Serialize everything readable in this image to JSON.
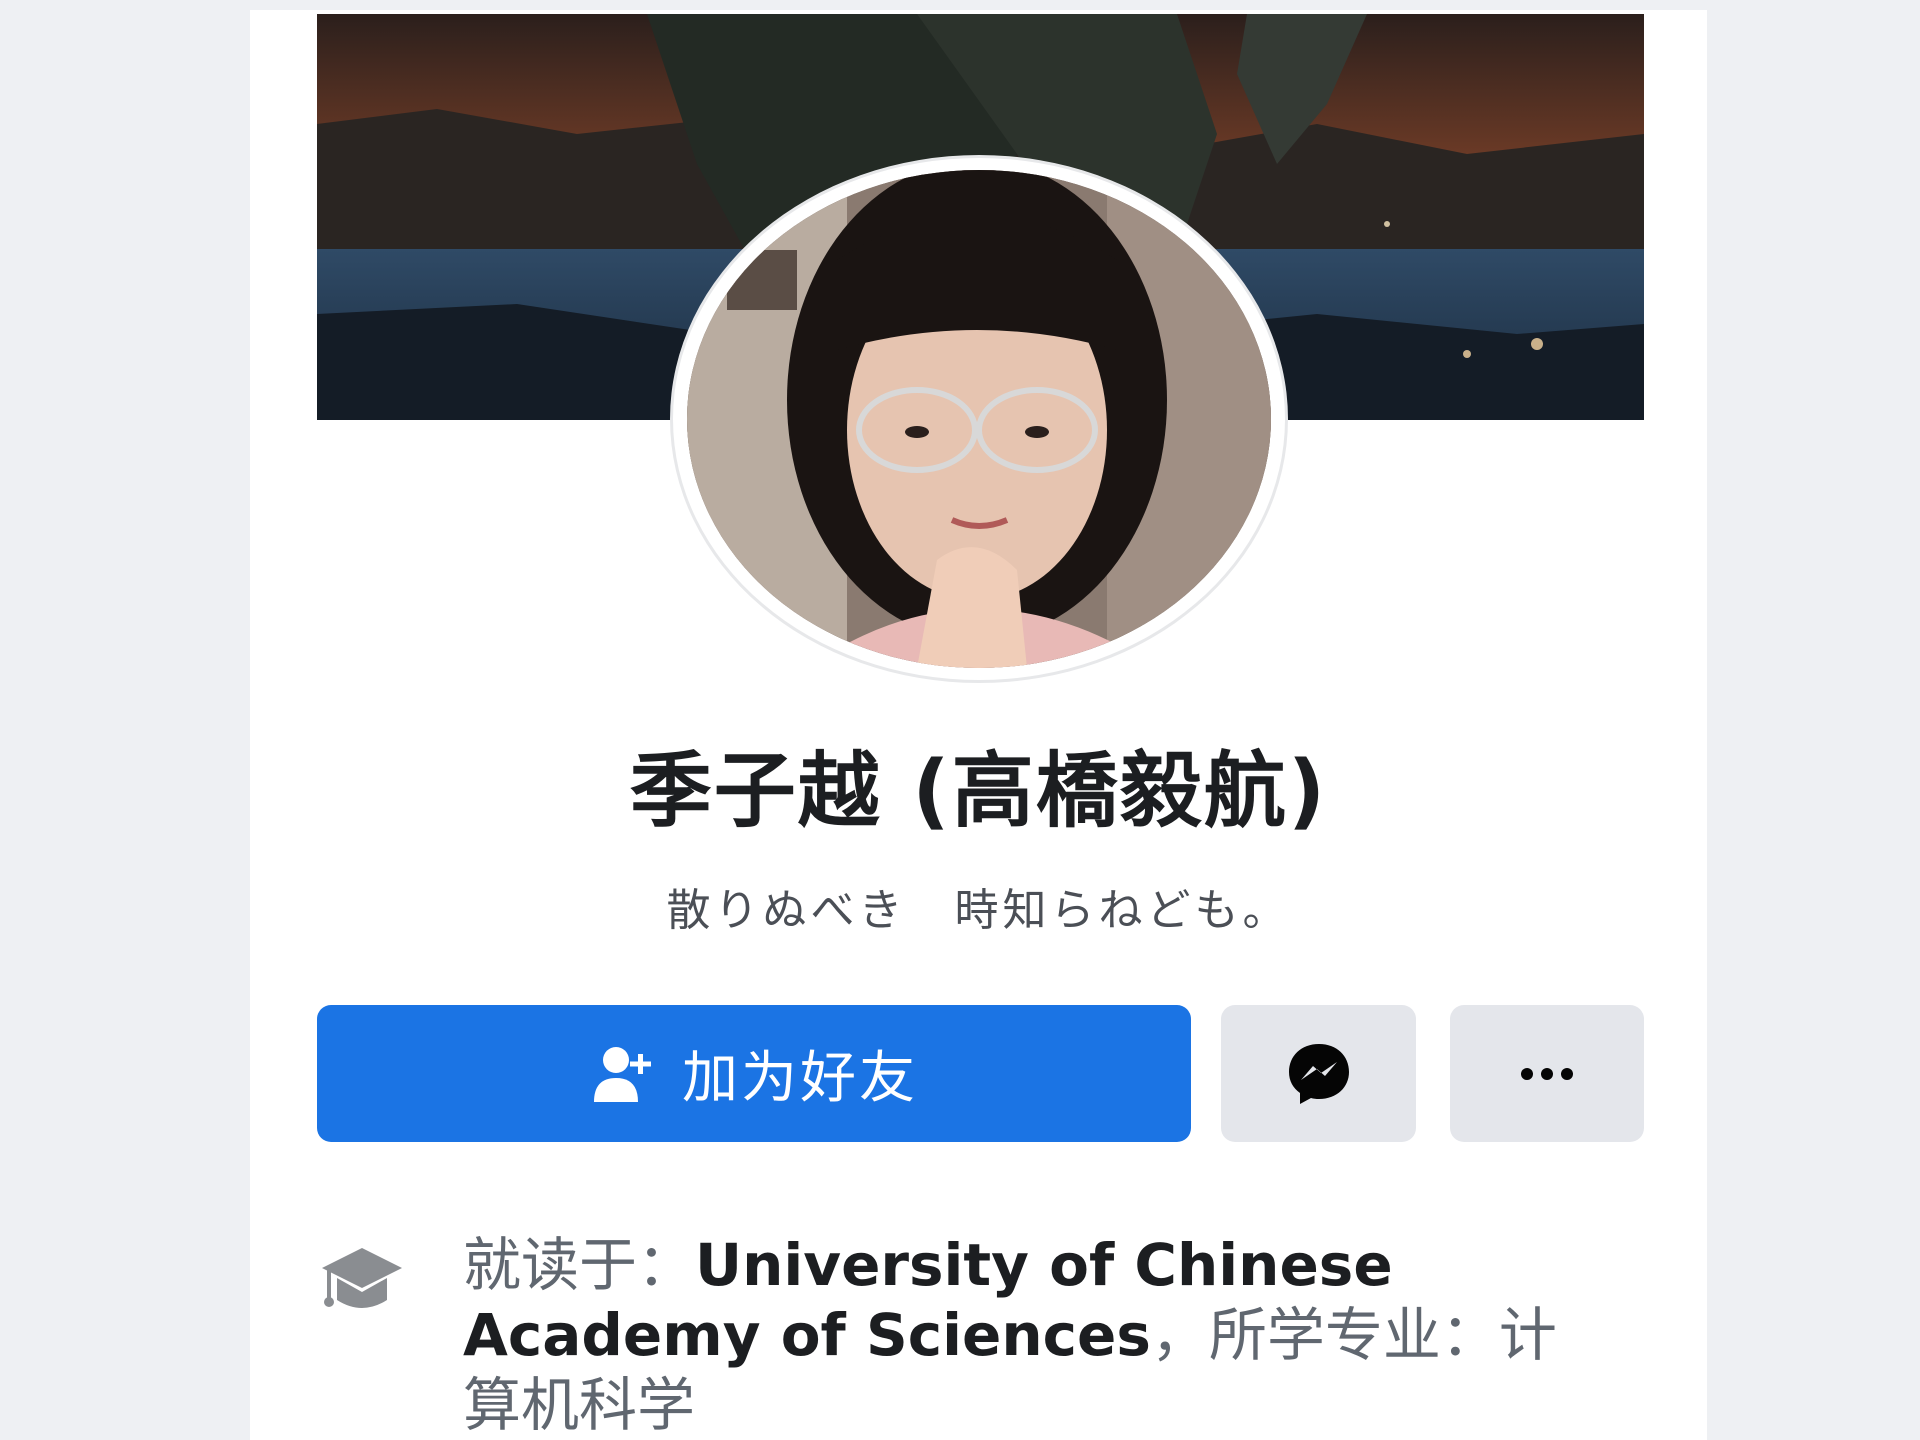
{
  "profile": {
    "name": "季子越 (高橋毅航)",
    "bio": "散りぬべき　時知らねども。"
  },
  "actions": {
    "add_friend_label": "加为好友",
    "add_friend_icon": "add-friend-icon",
    "message_icon": "messenger-icon",
    "more_icon": "more-icon"
  },
  "info": {
    "education_icon": "graduation-cap-icon",
    "studied_at_prefix": "就读于：",
    "school": "University of Chinese Academy of Sciences",
    "major_prefix": "，所学专业：",
    "major": "计算机科学"
  },
  "colors": {
    "primary_button": "#1b74e4",
    "secondary_button": "#e4e6eb",
    "name_text": "#1c1e21",
    "secondary_text": "#606770"
  }
}
